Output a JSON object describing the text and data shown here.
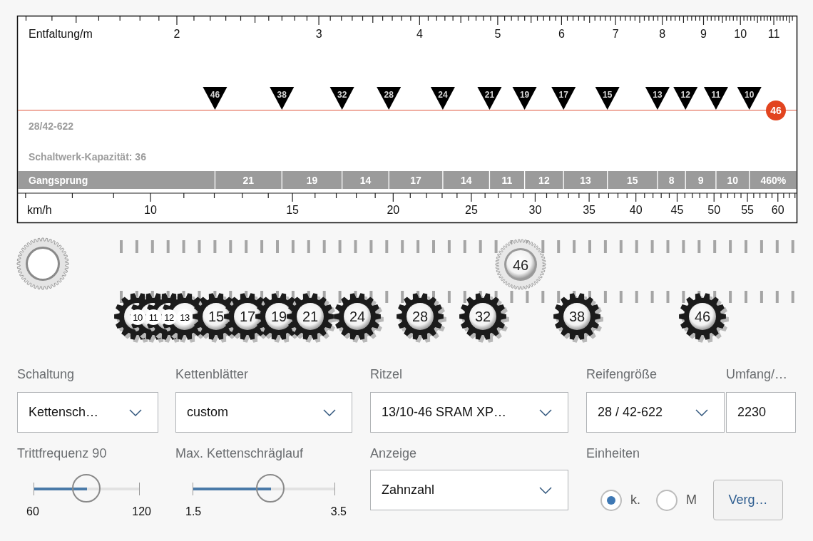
{
  "chart": {
    "scale_label": "Entfaltung/m",
    "scale_ticks": [
      "2",
      "3",
      "4",
      "5",
      "6",
      "7",
      "8",
      "9",
      "10",
      "11"
    ],
    "markers": [
      "46",
      "38",
      "32",
      "28",
      "24",
      "21",
      "19",
      "17",
      "15",
      "13",
      "12",
      "11",
      "10"
    ],
    "chainring_badge": "46",
    "tire_note": "28/42-622",
    "capacity_note": "Schaltwerk-Kapazität: 36",
    "steps_label": "Gangsprung",
    "steps": [
      "21",
      "19",
      "14",
      "17",
      "14",
      "11",
      "12",
      "13",
      "15",
      "8",
      "9",
      "10"
    ],
    "range": "460%",
    "speed_label": "km/h",
    "speed_ticks": [
      "10",
      "15",
      "20",
      "25",
      "30",
      "35",
      "40",
      "45",
      "50",
      "55",
      "60"
    ]
  },
  "drivetrain": {
    "chainring": "46",
    "cogs": [
      "10",
      "11",
      "12",
      "13",
      "15",
      "17",
      "19",
      "21",
      "24",
      "28",
      "32",
      "38",
      "46"
    ]
  },
  "fields": [
    {
      "label": "Schaltung",
      "kind": "select",
      "value": "Kettensch…"
    },
    {
      "label": "Kettenblätter",
      "kind": "select",
      "value": "custom"
    },
    {
      "label": "Ritzel",
      "kind": "select",
      "value": "13/10-46 SRAM XP…"
    },
    {
      "label": "Reifengröße",
      "kind": "select",
      "value": "28 / 42-622"
    },
    {
      "label": "Umfang/…",
      "kind": "input",
      "value": "2230"
    }
  ],
  "sliders": [
    {
      "label": "Trittfrequenz 90",
      "level": 0.5,
      "min": "60",
      "max": "120"
    },
    {
      "label": "Max. Kettenschräglauf",
      "level": 0.55,
      "min": "1.5",
      "max": "3.5"
    }
  ],
  "display": {
    "label": "Anzeige",
    "value": "Zahnzahl"
  },
  "units": {
    "label": "Einheiten",
    "options": [
      {
        "label": "k.",
        "selected": true
      },
      {
        "label": "M",
        "selected": false
      }
    ]
  },
  "compare_button": "Verg…"
}
